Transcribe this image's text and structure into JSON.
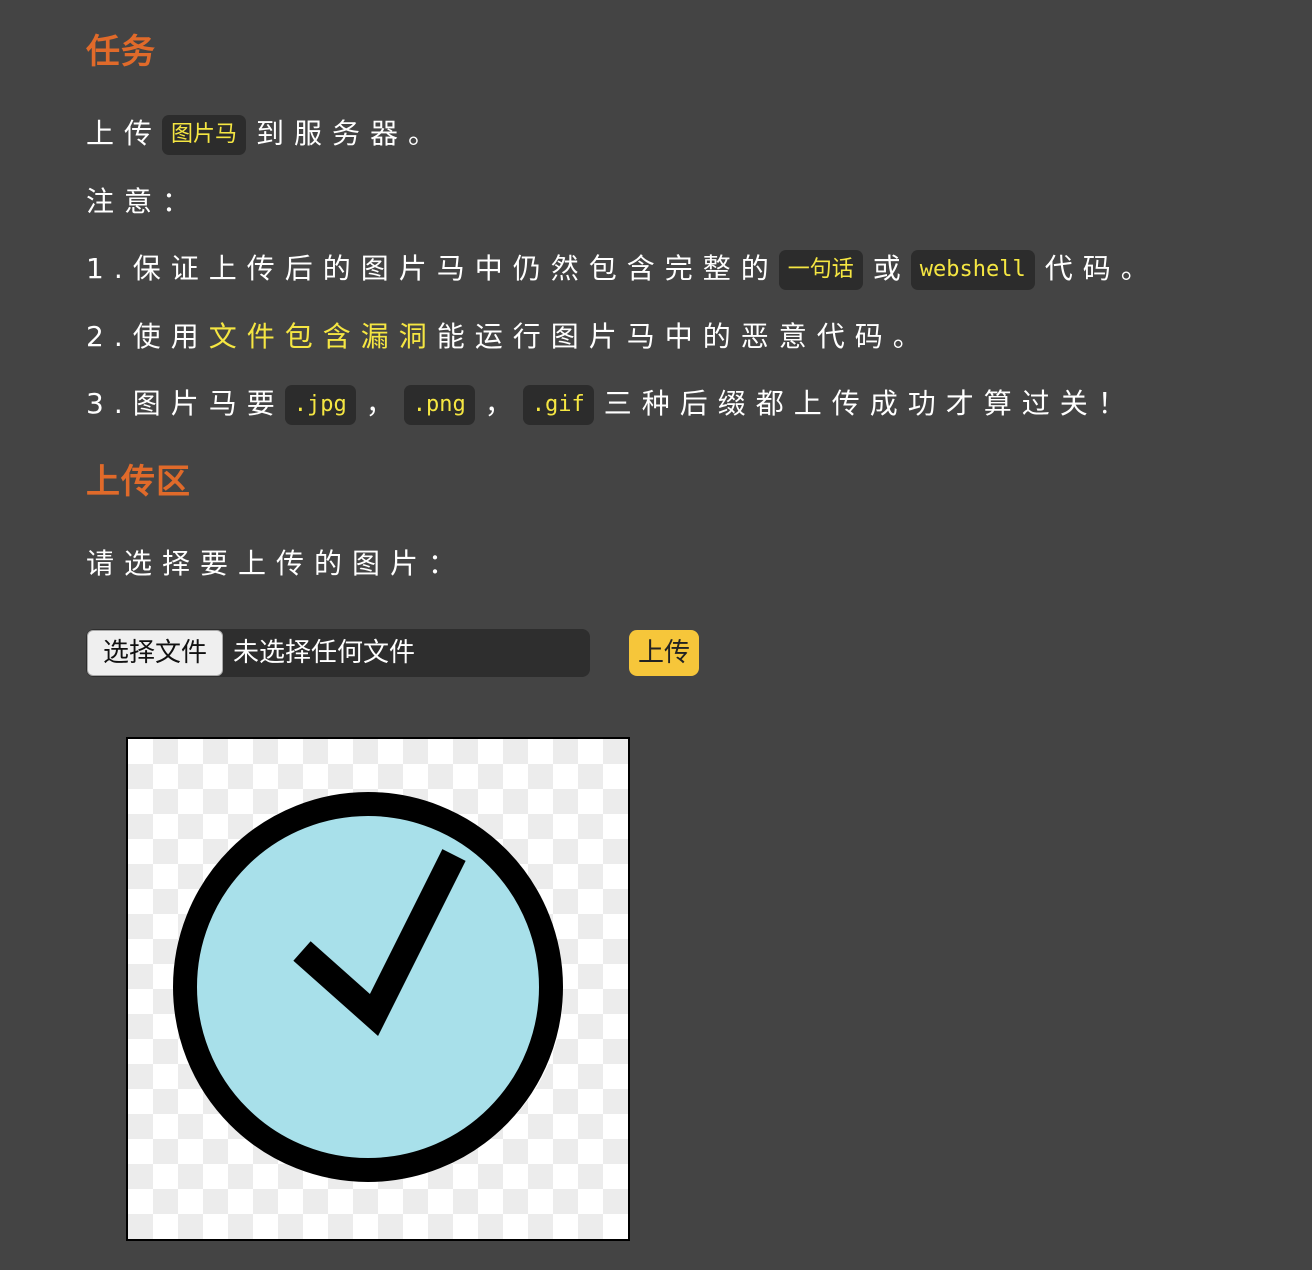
{
  "task": {
    "heading": "任务",
    "line1": {
      "pre": "上传",
      "code": "图片马",
      "post": "到服务器。"
    },
    "note_label": "注意：",
    "rule1": {
      "pre": "1.保证上传后的图片马中仍然包含完整的",
      "code1": "一句话",
      "mid": "或",
      "code2": "webshell",
      "post": "代码。"
    },
    "rule2": {
      "pre": "2.使用",
      "highlight": "文件包含漏洞",
      "post": "能运行图片马中的恶意代码。"
    },
    "rule3": {
      "pre": "3.图片马要",
      "code1": ".jpg",
      "sep1": "，",
      "code2": ".png",
      "sep2": "，",
      "code3": ".gif",
      "post": "三种后缀都上传成功才算过关！"
    }
  },
  "upload": {
    "heading": "上传区",
    "prompt": "请选择要上传的图片：",
    "choose_button": "选择文件",
    "no_file_text": "未选择任何文件",
    "submit_button": "上传"
  },
  "preview": {
    "icon": "check-circle-icon",
    "colors": {
      "fill": "#a8e0ea",
      "stroke": "#000000"
    }
  },
  "colors": {
    "background": "#444444",
    "heading": "#e06a2a",
    "highlight": "#f5e642",
    "upload_button": "#f6c63a"
  }
}
